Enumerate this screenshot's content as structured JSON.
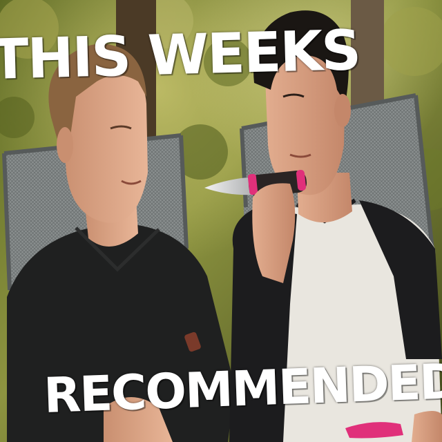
{
  "caption": {
    "top_line": "THIS WEEKS",
    "bottom_line": "RECOMMENDED"
  },
  "colors": {
    "foliage": "#6f7a2c",
    "chair_mesh": "#7d8282",
    "left_shirt": "#1f2020",
    "right_shirt_body": "#e9e6df",
    "right_shirt_sleeves": "#1c1c1e",
    "knife_handle": "#2a2424",
    "knife_accent": "#e0307a",
    "skin": "#d9a183",
    "caption_text": "#ffffff"
  },
  "icons": {
    "scene": "photo-two-men-outdoors-with-knife"
  }
}
